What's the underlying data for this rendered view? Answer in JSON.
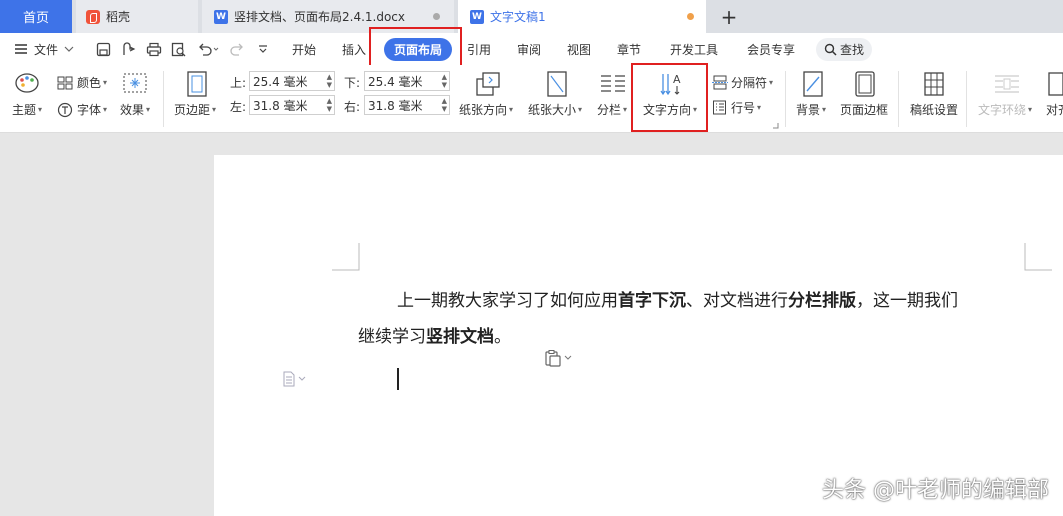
{
  "tabs": {
    "home": "首页",
    "daoke": "稻壳",
    "doc1": "竖排文档、页面布局2.4.1.docx",
    "doc2": "文字文稿1",
    "new_tab": "+"
  },
  "menu": {
    "file": "文件",
    "start": "开始",
    "insert": "插入",
    "layout": "页面布局",
    "reference": "引用",
    "review": "审阅",
    "view": "视图",
    "chapter": "章节",
    "devtools": "开发工具",
    "member": "会员专享",
    "search": "查找"
  },
  "ribbon": {
    "color": "颜色",
    "theme": "主题",
    "font": "字体",
    "effect": "效果",
    "margins": "页边距",
    "top_label": "上:",
    "top_value": "25.4 毫米",
    "bottom_label": "下:",
    "bottom_value": "25.4 毫米",
    "left_label": "左:",
    "left_value": "31.8 毫米",
    "right_label": "右:",
    "right_value": "31.8 毫米",
    "orientation": "纸张方向",
    "size": "纸张大小",
    "columns": "分栏",
    "text_direction": "文字方向",
    "breaks": "分隔符",
    "line_numbers": "行号",
    "background": "背景",
    "page_border": "页面边框",
    "manuscript": "稿纸设置",
    "text_wrap": "文字环绕",
    "align": "对齐"
  },
  "document": {
    "line1_a": "上一期教大家学习了如何应用",
    "line1_b": "首字下沉",
    "line1_c": "、对文档进行",
    "line1_d": "分栏排版",
    "line1_e": "，这一期我们",
    "line2_a": "继续学习",
    "line2_b": "竖排文档",
    "line2_c": "。"
  },
  "watermark": "头条 @叶老师的编辑部",
  "colors": {
    "accent": "#3e73e8",
    "highlight": "#e02020"
  }
}
